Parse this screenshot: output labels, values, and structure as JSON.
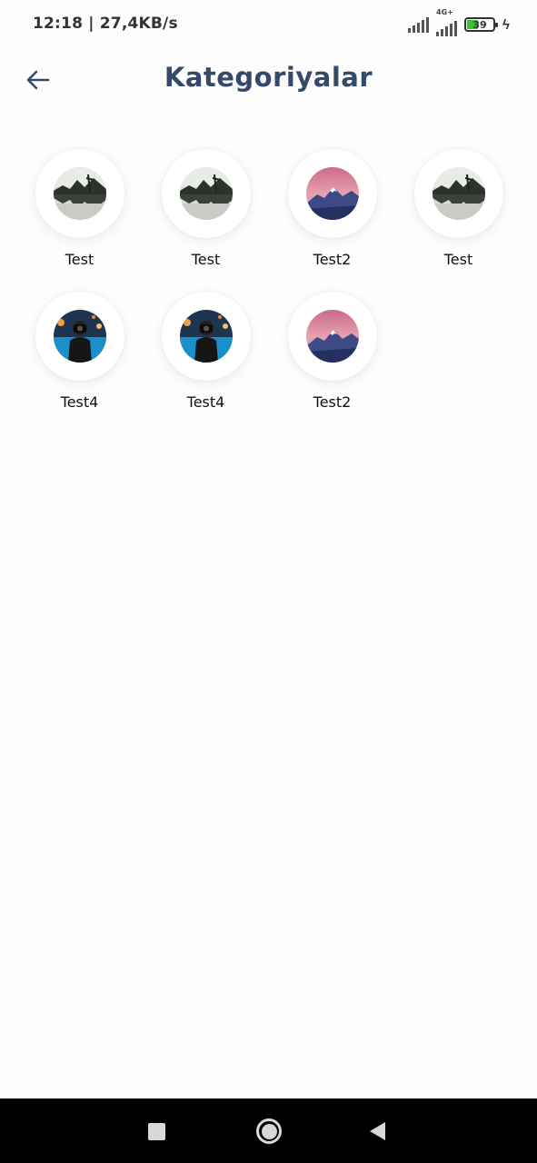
{
  "status_bar": {
    "time_speed": "12:18 | 27,4KB/s",
    "network_label": "4G+",
    "battery_level": "39",
    "icons": [
      "signal-icon",
      "signal-4g-icon",
      "battery-icon",
      "charging-icon"
    ]
  },
  "header": {
    "title": "Kategoriyalar",
    "back_icon": "arrow-left-icon"
  },
  "categories": [
    {
      "label": "Test",
      "image": "lake-reflection"
    },
    {
      "label": "Test",
      "image": "lake-reflection"
    },
    {
      "label": "Test2",
      "image": "pink-mountains"
    },
    {
      "label": "Test",
      "image": "lake-reflection"
    },
    {
      "label": "Test4",
      "image": "photographer-city"
    },
    {
      "label": "Test4",
      "image": "photographer-city"
    },
    {
      "label": "Test2",
      "image": "pink-mountains"
    }
  ],
  "nav_bar": {
    "icons": [
      "recents-icon",
      "home-icon",
      "back-icon"
    ]
  },
  "colors": {
    "title": "#35496b",
    "background": "#fefdfe",
    "nav_bar": "#000000"
  }
}
